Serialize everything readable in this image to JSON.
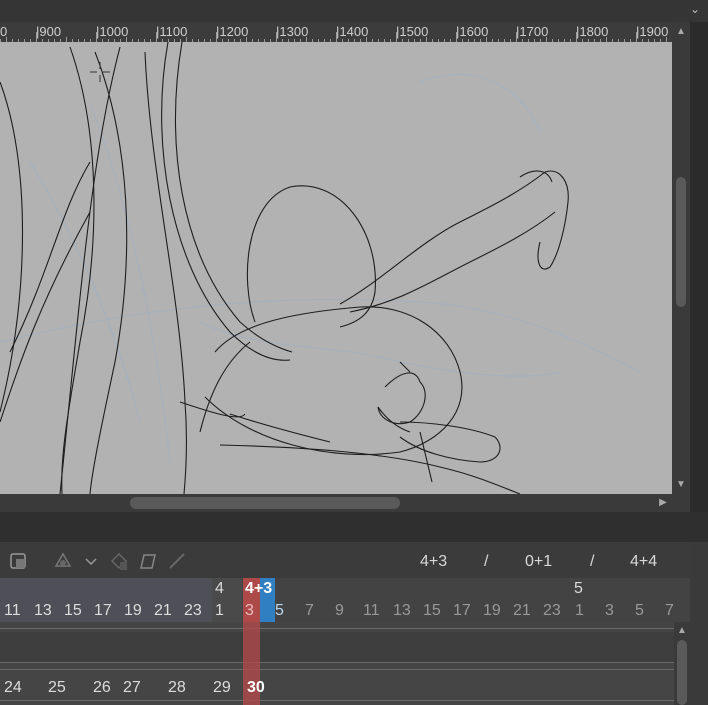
{
  "ruler": {
    "labels": [
      "|900",
      "|1000",
      "|1100",
      "|1200",
      "|1300",
      "|1400",
      "|1500",
      "|1600",
      "|1700",
      "|1800",
      "|1900"
    ],
    "start_label": "0"
  },
  "timeline": {
    "counters": {
      "current": "4+3",
      "sep1": "/",
      "middle": "0+1",
      "sep2": "/",
      "total": "4+4"
    },
    "header_top": {
      "section4": "4",
      "selected": "4+3",
      "section5": "5"
    },
    "frames_left": [
      "11",
      "13",
      "15",
      "17",
      "19",
      "21",
      "23"
    ],
    "frame_one": "1",
    "frame_selected": "3",
    "frame_next": "5",
    "frames_right": [
      "7",
      "9",
      "11",
      "13",
      "15",
      "17",
      "19",
      "21",
      "23"
    ],
    "frames_sec5": [
      "1",
      "3",
      "5",
      "7"
    ],
    "track_values": [
      "24",
      "25",
      "26",
      "27",
      "28",
      "29",
      "30"
    ]
  }
}
